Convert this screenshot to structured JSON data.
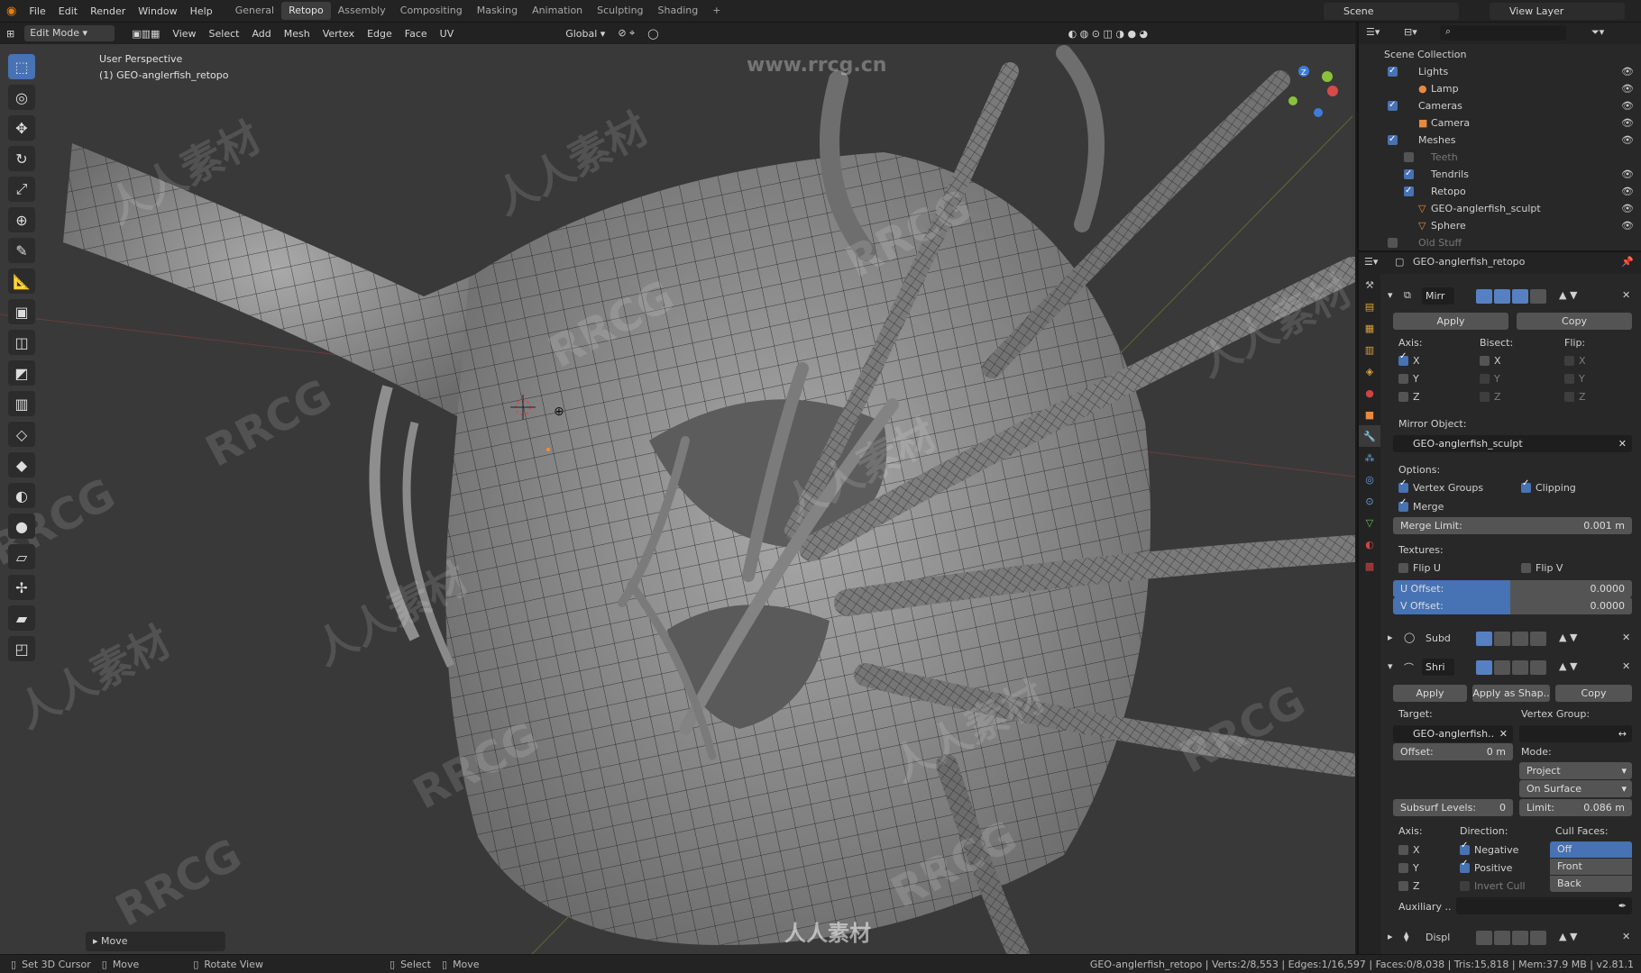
{
  "menu": [
    "File",
    "Edit",
    "Render",
    "Window",
    "Help"
  ],
  "workspaces": [
    "General",
    "Retopo",
    "Assembly",
    "Compositing",
    "Masking",
    "Animation",
    "Sculpting",
    "Shading"
  ],
  "active_workspace": "Retopo",
  "scene": "Scene",
  "view_layer": "View Layer",
  "header": {
    "mode": "Edit Mode",
    "menus": [
      "View",
      "Select",
      "Add",
      "Mesh",
      "Vertex",
      "Edge",
      "Face",
      "UV"
    ],
    "transform": "Global"
  },
  "viewport": {
    "perspective": "User Perspective",
    "object": "(1) GEO-anglerfish_retopo",
    "watermark_url": "www.rrcg.cn",
    "watermark_cn": "人人素材",
    "watermark": "RRCG",
    "last_op": "Move"
  },
  "outliner": {
    "root": "Scene Collection",
    "rows": [
      {
        "label": "Lights",
        "checked": true
      },
      {
        "label": "Lamp"
      },
      {
        "label": "Cameras",
        "checked": true
      },
      {
        "label": "Camera"
      },
      {
        "label": "Meshes",
        "checked": true
      },
      {
        "label": "Teeth",
        "checked": false
      },
      {
        "label": "Tendrils",
        "checked": true
      },
      {
        "label": "Retopo",
        "checked": true
      },
      {
        "label": "GEO-anglerfish_sculpt"
      },
      {
        "label": "Sphere"
      },
      {
        "label": "Old Stuff",
        "checked": false
      }
    ]
  },
  "props": {
    "object": "GEO-anglerfish_retopo",
    "mirror": {
      "name": "Mirr",
      "apply": "Apply",
      "copy": "Copy",
      "axis_label": "Axis:",
      "bisect_label": "Bisect:",
      "flip_label": "Flip:",
      "axes": [
        "X",
        "Y",
        "Z"
      ],
      "mirror_object_label": "Mirror Object:",
      "mirror_object": "GEO-anglerfish_sculpt",
      "options_label": "Options:",
      "vertex_groups": "Vertex Groups",
      "clipping": "Clipping",
      "merge": "Merge",
      "merge_limit_label": "Merge Limit:",
      "merge_limit": "0.001 m",
      "textures_label": "Textures:",
      "flip_u": "Flip U",
      "flip_v": "Flip V",
      "u_offset_label": "U Offset:",
      "u_offset": "0.0000",
      "v_offset_label": "V Offset:",
      "v_offset": "0.0000"
    },
    "subd": {
      "name": "Subd"
    },
    "shrink": {
      "name": "Shri",
      "apply": "Apply",
      "apply_shape": "Apply as Shap..",
      "copy": "Copy",
      "target_label": "Target:",
      "target": "GEO-anglerfish..",
      "vgroup_label": "Vertex Group:",
      "offset_label": "Offset:",
      "offset": "0 m",
      "mode_label": "Mode:",
      "mode": "Project",
      "on_surface": "On Surface",
      "subsurf_label": "Subsurf Levels:",
      "subsurf": "0",
      "limit_label": "Limit:",
      "limit": "0.086 m",
      "axis_label": "Axis:",
      "direction_label": "Direction:",
      "cull_label": "Cull Faces:",
      "negative": "Negative",
      "positive": "Positive",
      "invert_cull": "Invert Cull",
      "cull_options": [
        "Off",
        "Front",
        "Back"
      ],
      "auxiliary": "Auxiliary .."
    },
    "displ": {
      "name": "Displ"
    }
  },
  "status": {
    "left": [
      {
        "label": "Set 3D Cursor"
      },
      {
        "label": "Move"
      },
      {
        "label": "Rotate View"
      }
    ],
    "mid": [
      {
        "label": "Select"
      },
      {
        "label": "Move"
      }
    ],
    "stats": "GEO-anglerfish_retopo | Verts:2/8,553 | Edges:1/16,597 | Faces:0/8,038 | Tris:15,818 | Mem:37.9 MB | v2.81.1"
  }
}
